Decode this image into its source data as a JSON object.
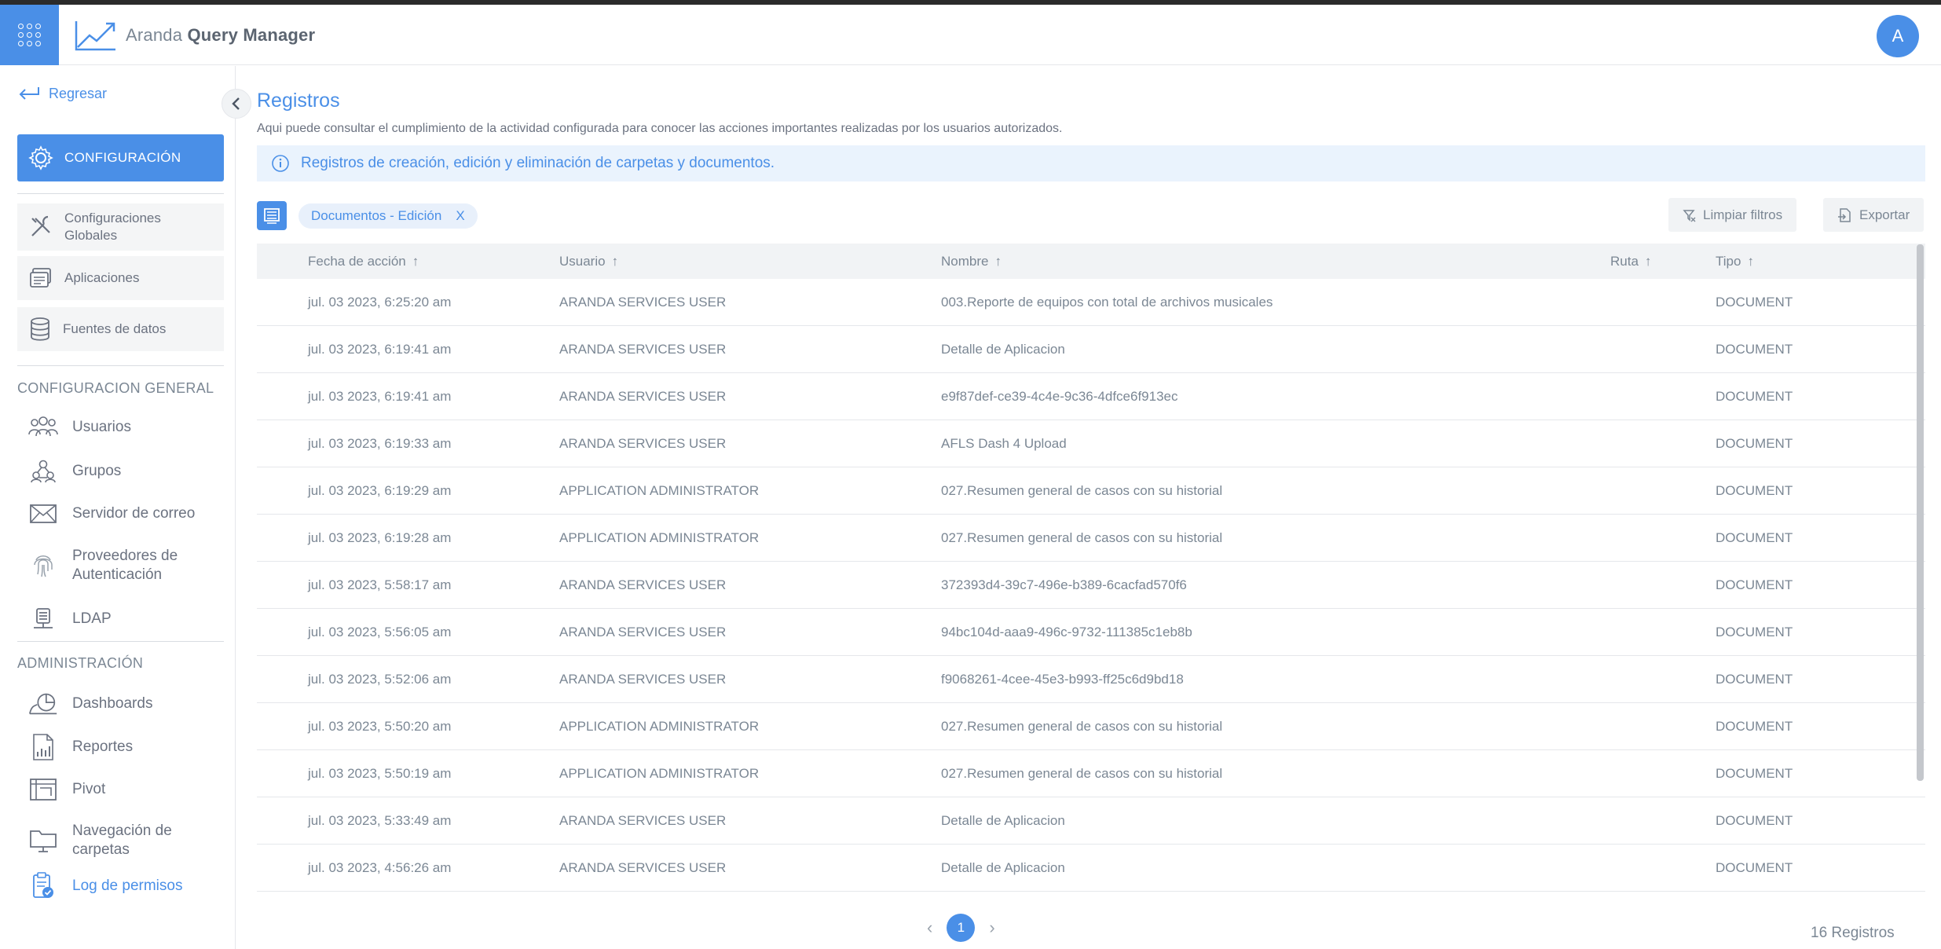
{
  "app": {
    "brand_light": "Aranda ",
    "brand_bold": "Query Manager",
    "avatar_initial": "A",
    "accent_color": "#4a8fe7"
  },
  "sidebar": {
    "back_label": "Regresar",
    "config_label": "CONFIGURACIÓN",
    "config_items": [
      {
        "label": "Configuraciones Globales",
        "icon": "tools-icon"
      },
      {
        "label": "Aplicaciones",
        "icon": "applications-icon"
      },
      {
        "label": "Fuentes de datos",
        "icon": "database-icon"
      }
    ],
    "general_title": "CONFIGURACION GENERAL",
    "general_items": [
      {
        "label": "Usuarios",
        "icon": "users-icon"
      },
      {
        "label": "Grupos",
        "icon": "groups-icon"
      },
      {
        "label": "Servidor de correo",
        "icon": "mail-icon"
      },
      {
        "label": "Proveedores de Autenticación",
        "icon": "fingerprint-icon"
      },
      {
        "label": "LDAP",
        "icon": "ldap-icon"
      }
    ],
    "admin_title": "ADMINISTRACIÓN",
    "admin_items": [
      {
        "label": "Dashboards",
        "icon": "dashboard-icon"
      },
      {
        "label": "Reportes",
        "icon": "report-icon"
      },
      {
        "label": "Pivot",
        "icon": "pivot-icon"
      },
      {
        "label": "Navegación de carpetas",
        "icon": "folder-icon"
      },
      {
        "label": "Log de permisos",
        "icon": "permissions-log-icon",
        "active": true
      }
    ]
  },
  "main": {
    "title": "Registros",
    "description": "Aqui puede consultar el cumplimiento de la actividad configurada para conocer las acciones importantes realizadas por los usuarios autorizados.",
    "info_text": "Registros de creación, edición y eliminación de carpetas y documentos.",
    "filter_chip": "Documentos - Edición",
    "filter_chip_close": "X",
    "clear_filters_label": "Limpiar filtros",
    "export_label": "Exportar"
  },
  "table": {
    "columns": [
      "Fecha de acción",
      "Usuario",
      "Nombre",
      "Ruta",
      "Tipo"
    ],
    "sort_glyph": "↑",
    "rows": [
      [
        "jul. 03 2023, 6:25:20 am",
        "ARANDA SERVICES USER",
        "003.Reporte de equipos con total de archivos musicales",
        "",
        "DOCUMENT"
      ],
      [
        "jul. 03 2023, 6:19:41 am",
        "ARANDA SERVICES USER",
        "Detalle de Aplicacion",
        "",
        "DOCUMENT"
      ],
      [
        "jul. 03 2023, 6:19:41 am",
        "ARANDA SERVICES USER",
        "e9f87def-ce39-4c4e-9c36-4dfce6f913ec",
        "",
        "DOCUMENT"
      ],
      [
        "jul. 03 2023, 6:19:33 am",
        "ARANDA SERVICES USER",
        "AFLS Dash 4 Upload",
        "",
        "DOCUMENT"
      ],
      [
        "jul. 03 2023, 6:19:29 am",
        "APPLICATION ADMINISTRATOR",
        "027.Resumen general de casos con su historial",
        "",
        "DOCUMENT"
      ],
      [
        "jul. 03 2023, 6:19:28 am",
        "APPLICATION ADMINISTRATOR",
        "027.Resumen general de casos con su historial",
        "",
        "DOCUMENT"
      ],
      [
        "jul. 03 2023, 5:58:17 am",
        "ARANDA SERVICES USER",
        "372393d4-39c7-496e-b389-6cacfad570f6",
        "",
        "DOCUMENT"
      ],
      [
        "jul. 03 2023, 5:56:05 am",
        "ARANDA SERVICES USER",
        "94bc104d-aaa9-496c-9732-111385c1eb8b",
        "",
        "DOCUMENT"
      ],
      [
        "jul. 03 2023, 5:52:06 am",
        "ARANDA SERVICES USER",
        "f9068261-4cee-45e3-b993-ff25c6d9bd18",
        "",
        "DOCUMENT"
      ],
      [
        "jul. 03 2023, 5:50:20 am",
        "APPLICATION ADMINISTRATOR",
        "027.Resumen general de casos con su historial",
        "",
        "DOCUMENT"
      ],
      [
        "jul. 03 2023, 5:50:19 am",
        "APPLICATION ADMINISTRATOR",
        "027.Resumen general de casos con su historial",
        "",
        "DOCUMENT"
      ],
      [
        "jul. 03 2023, 5:33:49 am",
        "ARANDA SERVICES USER",
        "Detalle de Aplicacion",
        "",
        "DOCUMENT"
      ],
      [
        "jul. 03 2023, 4:56:26 am",
        "ARANDA SERVICES USER",
        "Detalle de Aplicacion",
        "",
        "DOCUMENT"
      ]
    ]
  },
  "pagination": {
    "prev": "‹",
    "current": "1",
    "next": "›",
    "total_label": "16 Registros"
  }
}
